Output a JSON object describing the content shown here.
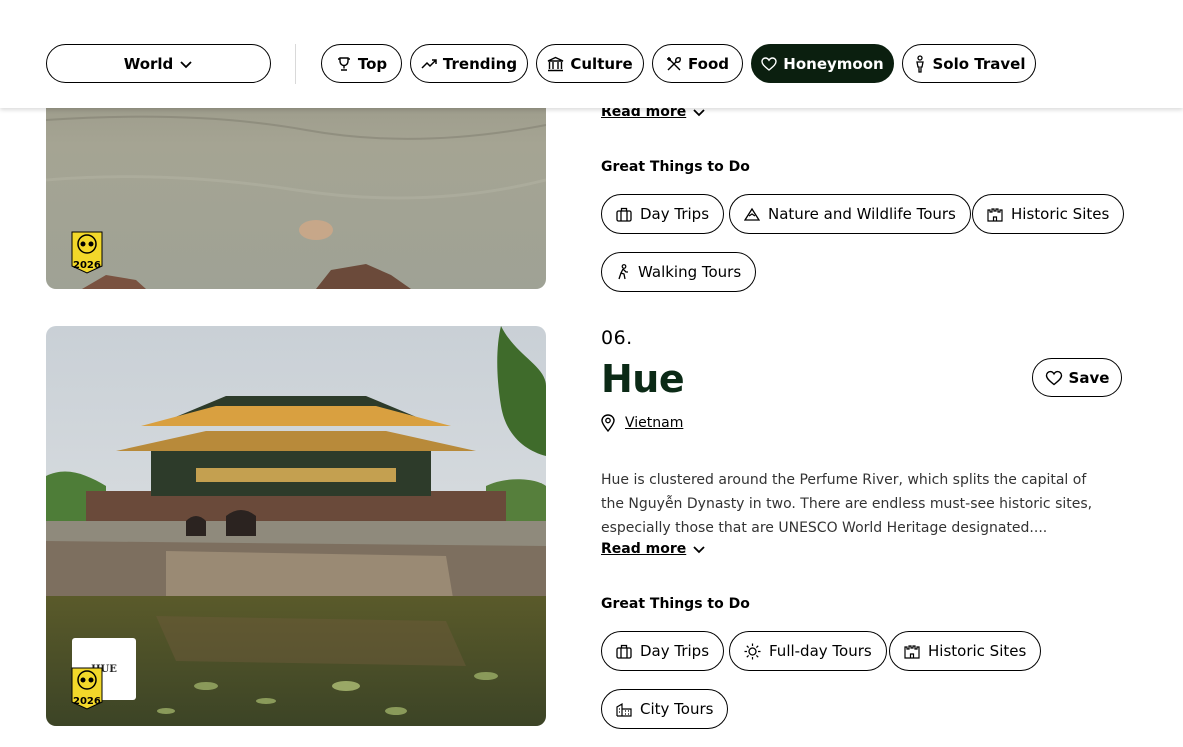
{
  "filters": {
    "region": "World",
    "chips": [
      {
        "label": "Top",
        "icon": "trophy-icon"
      },
      {
        "label": "Trending",
        "icon": "trending-up-icon"
      },
      {
        "label": "Culture",
        "icon": "museum-icon"
      },
      {
        "label": "Food",
        "icon": "utensils-icon"
      },
      {
        "label": "Honeymoon",
        "icon": "hearts-icon",
        "active": true
      },
      {
        "label": "Solo Travel",
        "icon": "person-icon"
      }
    ]
  },
  "cards": [
    {
      "read_more": "Read more",
      "things_title": "Great Things to Do",
      "things": [
        "Day Trips",
        "Nature and Wildlife Tours",
        "Historic Sites",
        "Walking Tours"
      ],
      "badge_year": "2026"
    },
    {
      "rank": "06.",
      "name": "Hue",
      "save_label": "Save",
      "location": "Vietnam",
      "description": "Hue is clustered around the Perfume River, which splits the capital of the Nguyễn Dynasty in two. There are endless must-see historic sites, especially those that are UNESCO World Heritage designated....",
      "read_more": "Read more",
      "things_title": "Great Things to Do",
      "things": [
        "Day Trips",
        "Full-day Tours",
        "Historic Sites",
        "City Tours"
      ],
      "badge_year": "2026",
      "photo_logo_text": "HUE"
    }
  ],
  "colors": {
    "brand_dark": "#0b1f0f",
    "title_green": "#0b2a16",
    "badge_yellow": "#f2d82a"
  }
}
